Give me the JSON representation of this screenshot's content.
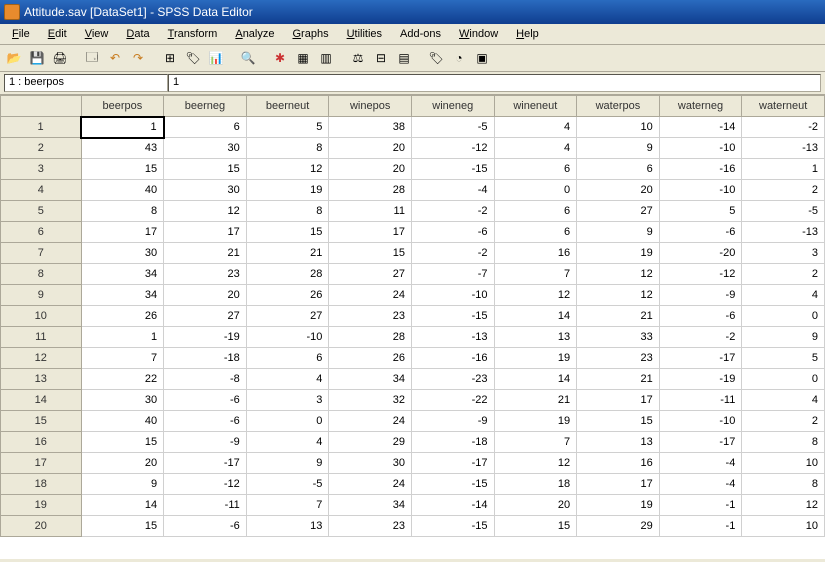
{
  "title": "Attitude.sav [DataSet1] - SPSS Data Editor",
  "menu": {
    "file": "File",
    "edit": "Edit",
    "view": "View",
    "data": "Data",
    "transform": "Transform",
    "analyze": "Analyze",
    "graphs": "Graphs",
    "utilities": "Utilities",
    "addons": "Add-ons",
    "window": "Window",
    "help": "Help"
  },
  "cellref": {
    "ref": "1 : beerpos",
    "val": "1"
  },
  "columns": [
    "beerpos",
    "beerneg",
    "beerneut",
    "winepos",
    "wineneg",
    "wineneut",
    "waterpos",
    "waterneg",
    "waterneut"
  ],
  "rownums": [
    "1",
    "2",
    "3",
    "4",
    "5",
    "6",
    "7",
    "8",
    "9",
    "10",
    "11",
    "12",
    "13",
    "14",
    "15",
    "16",
    "17",
    "18",
    "19",
    "20"
  ],
  "rows": [
    [
      1,
      6,
      5,
      38,
      -5,
      4,
      10,
      -14,
      -2
    ],
    [
      43,
      30,
      8,
      20,
      -12,
      4,
      9,
      -10,
      -13
    ],
    [
      15,
      15,
      12,
      20,
      -15,
      6,
      6,
      -16,
      1
    ],
    [
      40,
      30,
      19,
      28,
      -4,
      0,
      20,
      -10,
      2
    ],
    [
      8,
      12,
      8,
      11,
      -2,
      6,
      27,
      5,
      -5
    ],
    [
      17,
      17,
      15,
      17,
      -6,
      6,
      9,
      -6,
      -13
    ],
    [
      30,
      21,
      21,
      15,
      -2,
      16,
      19,
      -20,
      3
    ],
    [
      34,
      23,
      28,
      27,
      -7,
      7,
      12,
      -12,
      2
    ],
    [
      34,
      20,
      26,
      24,
      -10,
      12,
      12,
      -9,
      4
    ],
    [
      26,
      27,
      27,
      23,
      -15,
      14,
      21,
      -6,
      0
    ],
    [
      1,
      -19,
      -10,
      28,
      -13,
      13,
      33,
      -2,
      9
    ],
    [
      7,
      -18,
      6,
      26,
      -16,
      19,
      23,
      -17,
      5
    ],
    [
      22,
      -8,
      4,
      34,
      -23,
      14,
      21,
      -19,
      0
    ],
    [
      30,
      -6,
      3,
      32,
      -22,
      21,
      17,
      -11,
      4
    ],
    [
      40,
      -6,
      0,
      24,
      -9,
      19,
      15,
      -10,
      2
    ],
    [
      15,
      -9,
      4,
      29,
      -18,
      7,
      13,
      -17,
      8
    ],
    [
      20,
      -17,
      9,
      30,
      -17,
      12,
      16,
      -4,
      10
    ],
    [
      9,
      -12,
      -5,
      24,
      -15,
      18,
      17,
      -4,
      8
    ],
    [
      14,
      -11,
      7,
      34,
      -14,
      20,
      19,
      -1,
      12
    ],
    [
      15,
      -6,
      13,
      23,
      -15,
      15,
      29,
      -1,
      10
    ]
  ],
  "chart_data": {
    "type": "table",
    "title": "Attitude.sav [DataSet1]",
    "columns": [
      "beerpos",
      "beerneg",
      "beerneut",
      "winepos",
      "wineneg",
      "wineneut",
      "waterpos",
      "waterneg",
      "waterneut"
    ],
    "rows": [
      [
        1,
        6,
        5,
        38,
        -5,
        4,
        10,
        -14,
        -2
      ],
      [
        43,
        30,
        8,
        20,
        -12,
        4,
        9,
        -10,
        -13
      ],
      [
        15,
        15,
        12,
        20,
        -15,
        6,
        6,
        -16,
        1
      ],
      [
        40,
        30,
        19,
        28,
        -4,
        0,
        20,
        -10,
        2
      ],
      [
        8,
        12,
        8,
        11,
        -2,
        6,
        27,
        5,
        -5
      ],
      [
        17,
        17,
        15,
        17,
        -6,
        6,
        9,
        -6,
        -13
      ],
      [
        30,
        21,
        21,
        15,
        -2,
        16,
        19,
        -20,
        3
      ],
      [
        34,
        23,
        28,
        27,
        -7,
        7,
        12,
        -12,
        2
      ],
      [
        34,
        20,
        26,
        24,
        -10,
        12,
        12,
        -9,
        4
      ],
      [
        26,
        27,
        27,
        23,
        -15,
        14,
        21,
        -6,
        0
      ],
      [
        1,
        -19,
        -10,
        28,
        -13,
        13,
        33,
        -2,
        9
      ],
      [
        7,
        -18,
        6,
        26,
        -16,
        19,
        23,
        -17,
        5
      ],
      [
        22,
        -8,
        4,
        34,
        -23,
        14,
        21,
        -19,
        0
      ],
      [
        30,
        -6,
        3,
        32,
        -22,
        21,
        17,
        -11,
        4
      ],
      [
        40,
        -6,
        0,
        24,
        -9,
        19,
        15,
        -10,
        2
      ],
      [
        15,
        -9,
        4,
        29,
        -18,
        7,
        13,
        -17,
        8
      ],
      [
        20,
        -17,
        9,
        30,
        -17,
        12,
        16,
        -4,
        10
      ],
      [
        9,
        -12,
        -5,
        24,
        -15,
        18,
        17,
        -4,
        8
      ],
      [
        14,
        -11,
        7,
        34,
        -14,
        20,
        19,
        -1,
        12
      ],
      [
        15,
        -6,
        13,
        23,
        -15,
        15,
        29,
        -1,
        10
      ]
    ]
  }
}
